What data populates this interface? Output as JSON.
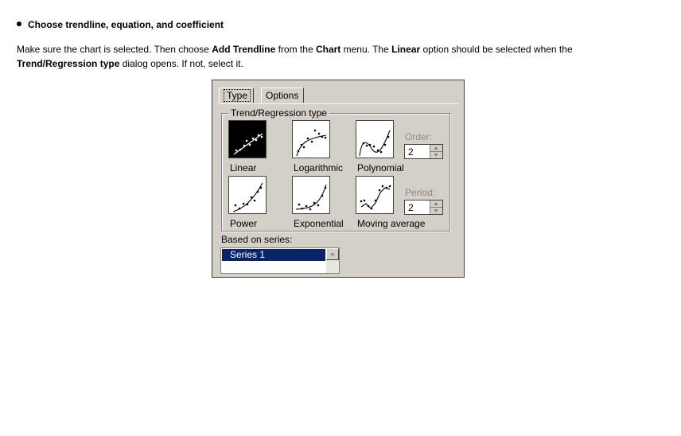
{
  "instructions": {
    "heading": "Choose trendline, equation, and coefficient",
    "line1_a": "Make sure the chart is selected. Then choose ",
    "line1_b": "Add Trendline",
    "line1_c": " from the ",
    "line1_d": "Chart",
    "line1_e": " menu. The ",
    "line1_f": "Linear",
    "line1_g": " option should be selected when the",
    "line2_a": "Trend/Regression type",
    "line2_b": " dialog opens. If not, select it."
  },
  "dialog": {
    "tabs": [
      {
        "label": "Type",
        "active": true
      },
      {
        "label": "Options",
        "active": false
      }
    ],
    "group_title": "Trend/Regression type",
    "types": [
      {
        "label": "Linear",
        "icon": "linear-trend-icon",
        "selected": true
      },
      {
        "label": "Logarithmic",
        "icon": "logarithmic-trend-icon",
        "selected": false
      },
      {
        "label": "Polynomial",
        "icon": "polynomial-trend-icon",
        "selected": false
      },
      {
        "label": "Power",
        "icon": "power-trend-icon",
        "selected": false
      },
      {
        "label": "Exponential",
        "icon": "exponential-trend-icon",
        "selected": false
      },
      {
        "label": "Moving average",
        "icon": "moving-average-trend-icon",
        "selected": false
      }
    ],
    "order": {
      "label": "Order:",
      "value": "2",
      "enabled": false
    },
    "period": {
      "label": "Period:",
      "value": "2",
      "enabled": false
    },
    "based_on_label": "Based on series:",
    "series": [
      "Series 1"
    ],
    "selected_series": "Series 1",
    "colors": {
      "selection": "#0a246a",
      "dialog_bg": "#d4d0c8"
    }
  }
}
